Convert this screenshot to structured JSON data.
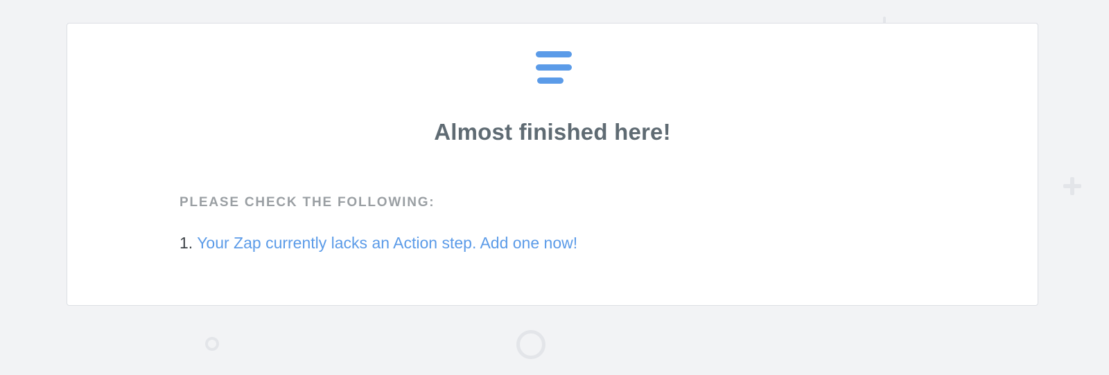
{
  "colors": {
    "background": "#f2f3f5",
    "card": "#ffffff",
    "accent": "#5b9be8",
    "heading": "#5f6b73",
    "label": "#9a9fa3",
    "decoration": "#e3e5e9"
  },
  "card": {
    "icon": "filter-lines-icon",
    "title": "Almost finished here!",
    "checklist_label": "PLEASE CHECK THE FOLLOWING:",
    "items": [
      {
        "number": "1.",
        "link_text": "Your Zap currently lacks an Action step. Add one now!"
      }
    ]
  },
  "decorations": [
    "plus-icon",
    "ring-icon",
    "ring-icon"
  ]
}
